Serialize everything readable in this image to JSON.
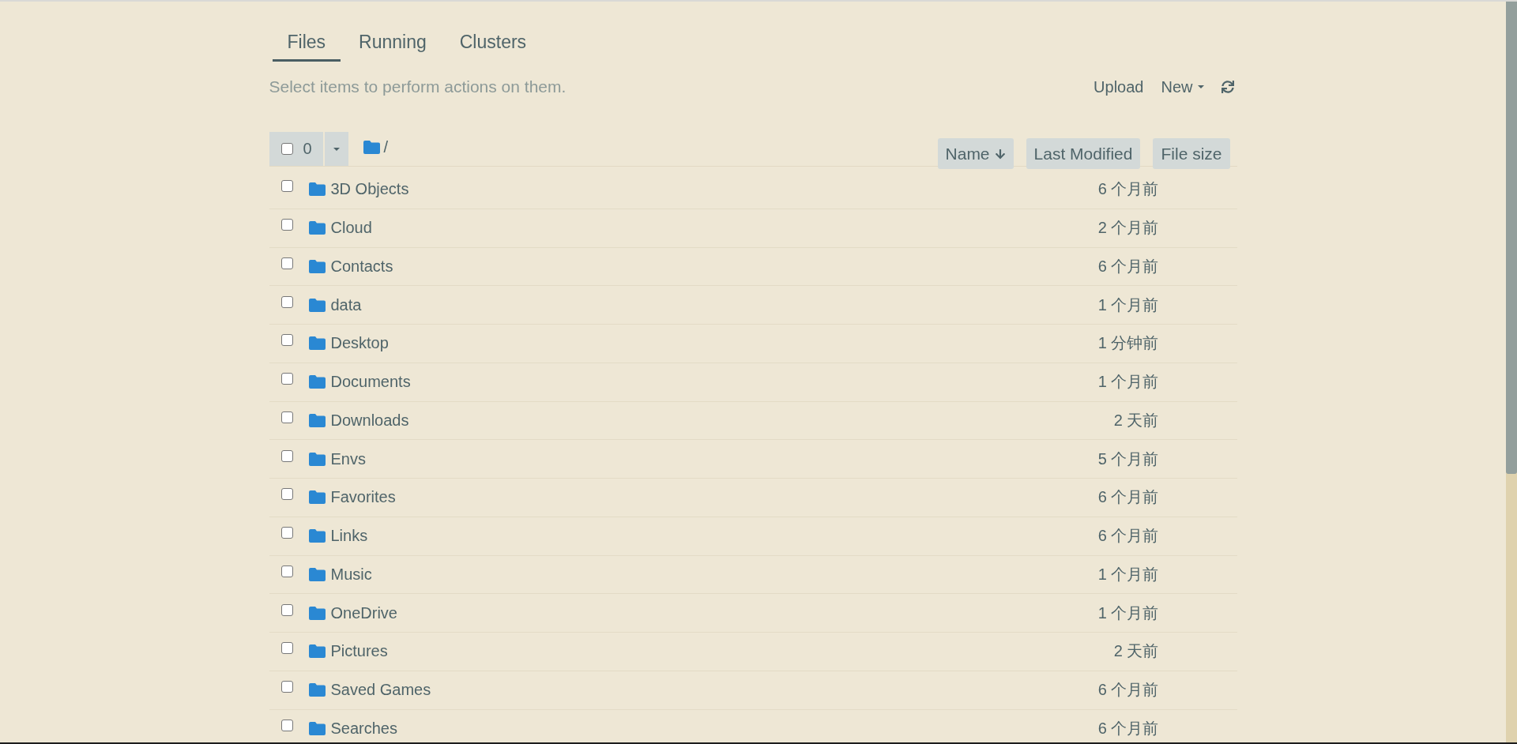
{
  "tabs": [
    {
      "label": "Files",
      "selected": true
    },
    {
      "label": "Running",
      "selected": false
    },
    {
      "label": "Clusters",
      "selected": false
    }
  ],
  "hint": "Select items to perform actions on them.",
  "actions": {
    "upload": "Upload",
    "new": "New"
  },
  "toolbar": {
    "select_all_checked": false,
    "selected_count": "0",
    "path": "/"
  },
  "sort_buttons": [
    {
      "label": "Name",
      "sorted": true
    },
    {
      "label": "Last Modified",
      "sorted": false
    },
    {
      "label": "File size",
      "sorted": false
    }
  ],
  "rows": [
    {
      "name": "3D Objects",
      "modified": "6 个月前",
      "checked": false
    },
    {
      "name": "Cloud",
      "modified": "2 个月前",
      "checked": false
    },
    {
      "name": "Contacts",
      "modified": "6 个月前",
      "checked": false
    },
    {
      "name": "data",
      "modified": "1 个月前",
      "checked": false
    },
    {
      "name": "Desktop",
      "modified": "1 分钟前",
      "checked": false
    },
    {
      "name": "Documents",
      "modified": "1 个月前",
      "checked": false
    },
    {
      "name": "Downloads",
      "modified": "2 天前",
      "checked": false
    },
    {
      "name": "Envs",
      "modified": "5 个月前",
      "checked": false
    },
    {
      "name": "Favorites",
      "modified": "6 个月前",
      "checked": false
    },
    {
      "name": "Links",
      "modified": "6 个月前",
      "checked": false
    },
    {
      "name": "Music",
      "modified": "1 个月前",
      "checked": false
    },
    {
      "name": "OneDrive",
      "modified": "1 个月前",
      "checked": false
    },
    {
      "name": "Pictures",
      "modified": "2 天前",
      "checked": false
    },
    {
      "name": "Saved Games",
      "modified": "6 个月前",
      "checked": false
    },
    {
      "name": "Searches",
      "modified": "6 个月前",
      "checked": false
    }
  ]
}
